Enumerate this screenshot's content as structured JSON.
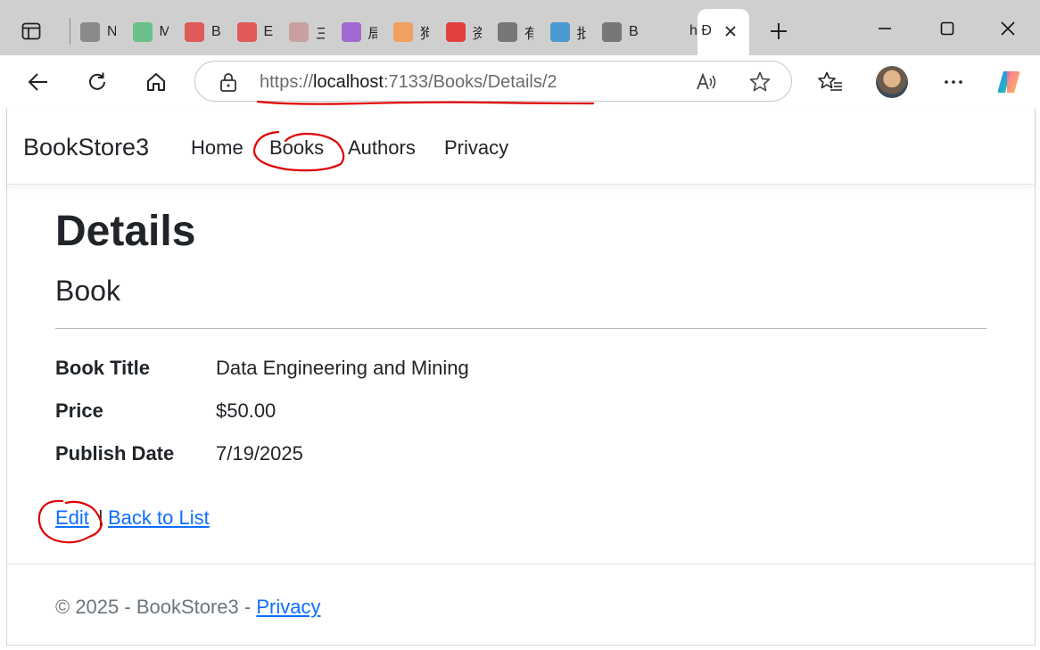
{
  "browser": {
    "tabs": [
      {
        "letter": "N",
        "icon": "calendar-icon",
        "color": "#8a8a8a"
      },
      {
        "letter": "M",
        "icon": "und-icon",
        "color": "#6abf8a"
      },
      {
        "letter": "B",
        "icon": "opera-icon",
        "color": "#e05a5a"
      },
      {
        "letter": "E",
        "icon": "opera-icon",
        "color": "#e05a5a"
      },
      {
        "letter": "三",
        "icon": "w-icon",
        "color": "#c9a0a0"
      },
      {
        "letter": "局",
        "icon": "slash-icon",
        "color": "#a06ad0"
      },
      {
        "letter": "狗",
        "icon": "face-icon",
        "color": "#f0a060"
      },
      {
        "letter": "资",
        "icon": "zhong-icon",
        "color": "#e04040"
      },
      {
        "letter": "有",
        "icon": "globe-icon",
        "color": "#777777"
      },
      {
        "letter": "批",
        "icon": "note-icon",
        "color": "#4a9ad0"
      },
      {
        "letter": "B",
        "icon": "globe-icon",
        "color": "#777777"
      }
    ],
    "active_tab_label": "h Đ",
    "url_scheme": "https://",
    "url_host": "localhost",
    "url_rest": ":7133/Books/Details/2"
  },
  "navbar": {
    "brand": "BookStore3",
    "links": [
      "Home",
      "Books",
      "Authors",
      "Privacy"
    ]
  },
  "page": {
    "title": "Details",
    "subtitle": "Book",
    "fields": [
      {
        "label": "Book Title",
        "value": "Data Engineering and Mining"
      },
      {
        "label": "Price",
        "value": "$50.00"
      },
      {
        "label": "Publish Date",
        "value": "7/19/2025"
      }
    ],
    "edit_link": "Edit",
    "separator": "|",
    "back_link": "Back to List"
  },
  "footer": {
    "text": "© 2025 - BookStore3 -",
    "privacy": "Privacy"
  },
  "annotation_color": "#e00000"
}
